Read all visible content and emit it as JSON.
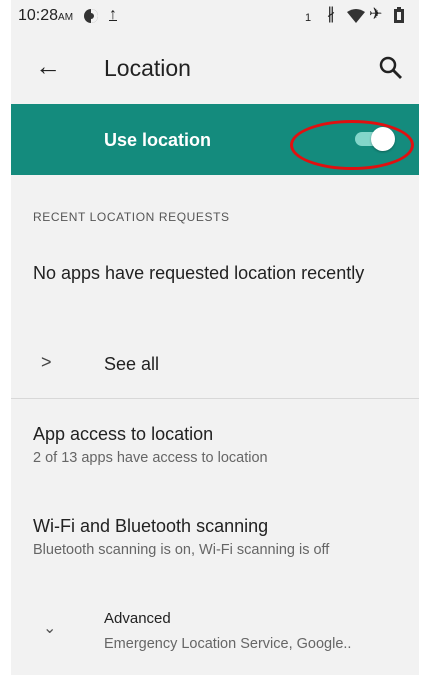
{
  "status_bar": {
    "time": "10:28",
    "ampm": "AM",
    "icons": [
      "data-saver-icon",
      "upload-icon",
      "sim-icon",
      "bluetooth-icon",
      "wifi-icon",
      "airplane-icon",
      "battery-icon"
    ]
  },
  "app_bar": {
    "title": "Location",
    "back_icon": "arrow-back-icon",
    "search_icon": "search-icon"
  },
  "master_switch": {
    "label": "Use location",
    "checked": true,
    "accent": "#148b7d",
    "highlight_color": "#e01010"
  },
  "recent_requests": {
    "header": "RECENT LOCATION REQUESTS",
    "empty_text": "No apps have requested location recently",
    "see_all_label": "See all"
  },
  "preferences": [
    {
      "title": "App access to location",
      "summary": "2 of 13 apps have access to location"
    },
    {
      "title": "Wi-Fi and Bluetooth scanning",
      "summary": "Bluetooth scanning is on, Wi-Fi scanning is off"
    }
  ],
  "advanced": {
    "title": "Advanced",
    "summary": "Emergency Location Service, Google.."
  }
}
